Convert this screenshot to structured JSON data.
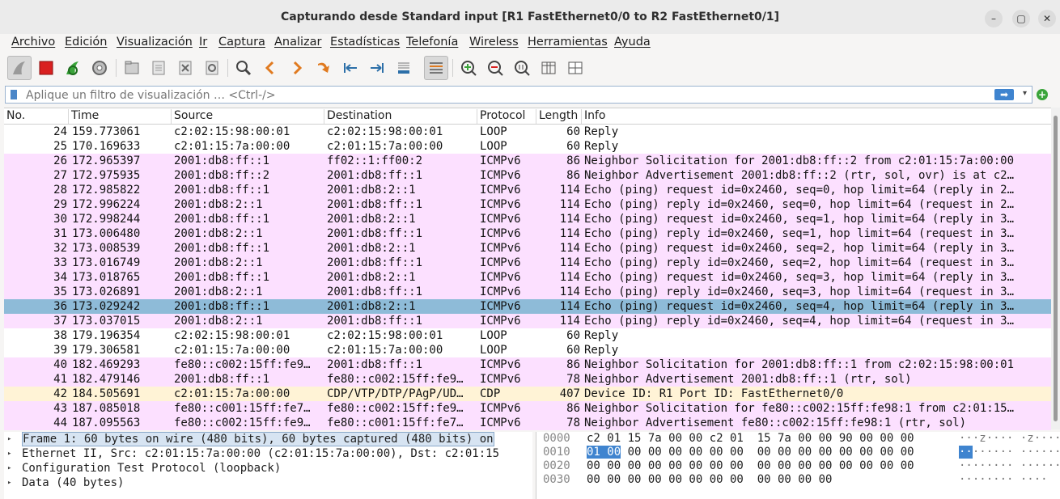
{
  "window": {
    "title": "Capturando desde Standard input [R1 FastEthernet0/0 to R2 FastEthernet0/1]",
    "minimize": "–",
    "maximize": "▢",
    "close": "✕"
  },
  "menu": [
    "Archivo",
    "Edición",
    "Visualización",
    "Ir",
    "Captura",
    "Analizar",
    "Estadísticas",
    "Telefonía",
    "Wireless",
    "Herramientas",
    "Ayuda"
  ],
  "toolbar_icons": [
    "shark-fin-icon",
    "stop-capture-icon",
    "restart-capture-icon",
    "capture-options-icon",
    "open-file-icon",
    "save-file-icon",
    "close-file-icon",
    "reload-file-icon",
    "find-packet-icon",
    "go-back-icon",
    "go-forward-icon",
    "go-to-packet-icon",
    "first-packet-icon",
    "last-packet-icon",
    "auto-scroll-icon",
    "colorize-icon",
    "zoom-in-icon",
    "zoom-out-icon",
    "normal-size-icon",
    "resize-columns-icon"
  ],
  "filter": {
    "placeholder": "Aplique un filtro de visualización … <Ctrl-/>",
    "apply": "➡",
    "dropdown": "▾",
    "add": "+"
  },
  "columns": [
    "No.",
    "Time",
    "Source",
    "Destination",
    "Protocol",
    "Length",
    "Info"
  ],
  "packets": [
    {
      "no": "24",
      "time": "159.773061",
      "src": "c2:02:15:98:00:01",
      "dst": "c2:02:15:98:00:01",
      "proto": "LOOP",
      "len": "60",
      "info": "Reply",
      "kind": "loop"
    },
    {
      "no": "25",
      "time": "170.169633",
      "src": "c2:01:15:7a:00:00",
      "dst": "c2:01:15:7a:00:00",
      "proto": "LOOP",
      "len": "60",
      "info": "Reply",
      "kind": "loop"
    },
    {
      "no": "26",
      "time": "172.965397",
      "src": "2001:db8:ff::1",
      "dst": "ff02::1:ff00:2",
      "proto": "ICMPv6",
      "len": "86",
      "info": "Neighbor Solicitation for 2001:db8:ff::2 from c2:01:15:7a:00:00",
      "kind": "icmp"
    },
    {
      "no": "27",
      "time": "172.975935",
      "src": "2001:db8:ff::2",
      "dst": "2001:db8:ff::1",
      "proto": "ICMPv6",
      "len": "86",
      "info": "Neighbor Advertisement 2001:db8:ff::2 (rtr, sol, ovr) is at c2…",
      "kind": "icmp"
    },
    {
      "no": "28",
      "time": "172.985822",
      "src": "2001:db8:ff::1",
      "dst": "2001:db8:2::1",
      "proto": "ICMPv6",
      "len": "114",
      "info": "Echo (ping) request id=0x2460, seq=0, hop limit=64 (reply in 2…",
      "kind": "icmp"
    },
    {
      "no": "29",
      "time": "172.996224",
      "src": "2001:db8:2::1",
      "dst": "2001:db8:ff::1",
      "proto": "ICMPv6",
      "len": "114",
      "info": "Echo (ping) reply id=0x2460, seq=0, hop limit=64 (request in 2…",
      "kind": "icmp"
    },
    {
      "no": "30",
      "time": "172.998244",
      "src": "2001:db8:ff::1",
      "dst": "2001:db8:2::1",
      "proto": "ICMPv6",
      "len": "114",
      "info": "Echo (ping) request id=0x2460, seq=1, hop limit=64 (reply in 3…",
      "kind": "icmp"
    },
    {
      "no": "31",
      "time": "173.006480",
      "src": "2001:db8:2::1",
      "dst": "2001:db8:ff::1",
      "proto": "ICMPv6",
      "len": "114",
      "info": "Echo (ping) reply id=0x2460, seq=1, hop limit=64 (request in 3…",
      "kind": "icmp"
    },
    {
      "no": "32",
      "time": "173.008539",
      "src": "2001:db8:ff::1",
      "dst": "2001:db8:2::1",
      "proto": "ICMPv6",
      "len": "114",
      "info": "Echo (ping) request id=0x2460, seq=2, hop limit=64 (reply in 3…",
      "kind": "icmp"
    },
    {
      "no": "33",
      "time": "173.016749",
      "src": "2001:db8:2::1",
      "dst": "2001:db8:ff::1",
      "proto": "ICMPv6",
      "len": "114",
      "info": "Echo (ping) reply id=0x2460, seq=2, hop limit=64 (request in 3…",
      "kind": "icmp"
    },
    {
      "no": "34",
      "time": "173.018765",
      "src": "2001:db8:ff::1",
      "dst": "2001:db8:2::1",
      "proto": "ICMPv6",
      "len": "114",
      "info": "Echo (ping) request id=0x2460, seq=3, hop limit=64 (reply in 3…",
      "kind": "icmp"
    },
    {
      "no": "35",
      "time": "173.026891",
      "src": "2001:db8:2::1",
      "dst": "2001:db8:ff::1",
      "proto": "ICMPv6",
      "len": "114",
      "info": "Echo (ping) reply id=0x2460, seq=3, hop limit=64 (request in 3…",
      "kind": "icmp"
    },
    {
      "no": "36",
      "time": "173.029242",
      "src": "2001:db8:ff::1",
      "dst": "2001:db8:2::1",
      "proto": "ICMPv6",
      "len": "114",
      "info": "Echo (ping) request id=0x2460, seq=4, hop limit=64 (reply in 3…",
      "kind": "sel"
    },
    {
      "no": "37",
      "time": "173.037015",
      "src": "2001:db8:2::1",
      "dst": "2001:db8:ff::1",
      "proto": "ICMPv6",
      "len": "114",
      "info": "Echo (ping) reply id=0x2460, seq=4, hop limit=64 (request in 3…",
      "kind": "icmp"
    },
    {
      "no": "38",
      "time": "179.196354",
      "src": "c2:02:15:98:00:01",
      "dst": "c2:02:15:98:00:01",
      "proto": "LOOP",
      "len": "60",
      "info": "Reply",
      "kind": "loop"
    },
    {
      "no": "39",
      "time": "179.306581",
      "src": "c2:01:15:7a:00:00",
      "dst": "c2:01:15:7a:00:00",
      "proto": "LOOP",
      "len": "60",
      "info": "Reply",
      "kind": "loop"
    },
    {
      "no": "40",
      "time": "182.469293",
      "src": "fe80::c002:15ff:fe9…",
      "dst": "2001:db8:ff::1",
      "proto": "ICMPv6",
      "len": "86",
      "info": "Neighbor Solicitation for 2001:db8:ff::1 from c2:02:15:98:00:01",
      "kind": "icmp"
    },
    {
      "no": "41",
      "time": "182.479146",
      "src": "2001:db8:ff::1",
      "dst": "fe80::c002:15ff:fe9…",
      "proto": "ICMPv6",
      "len": "78",
      "info": "Neighbor Advertisement 2001:db8:ff::1 (rtr, sol)",
      "kind": "icmp"
    },
    {
      "no": "42",
      "time": "184.505691",
      "src": "c2:01:15:7a:00:00",
      "dst": "CDP/VTP/DTP/PAgP/UD…",
      "proto": "CDP",
      "len": "407",
      "info": "Device ID: R1  Port ID: FastEthernet0/0",
      "kind": "cdp"
    },
    {
      "no": "43",
      "time": "187.085018",
      "src": "fe80::c001:15ff:fe7…",
      "dst": "fe80::c002:15ff:fe9…",
      "proto": "ICMPv6",
      "len": "86",
      "info": "Neighbor Solicitation for fe80::c002:15ff:fe98:1 from c2:01:15…",
      "kind": "icmp"
    },
    {
      "no": "44",
      "time": "187.095563",
      "src": "fe80::c002:15ff:fe9…",
      "dst": "fe80::c001:15ff:fe7…",
      "proto": "ICMPv6",
      "len": "78",
      "info": "Neighbor Advertisement fe80::c002:15ff:fe98:1 (rtr, sol)",
      "kind": "icmp"
    }
  ],
  "details": [
    {
      "text": "Frame 1: 60 bytes on wire (480 bits), 60 bytes captured (480 bits) on",
      "selected": true
    },
    {
      "text": "Ethernet II, Src: c2:01:15:7a:00:00 (c2:01:15:7a:00:00), Dst: c2:01:15",
      "selected": false
    },
    {
      "text": "Configuration Test Protocol (loopback)",
      "selected": false
    },
    {
      "text": "Data (40 bytes)",
      "selected": false
    }
  ],
  "detail_expander": "▸",
  "bytes": [
    {
      "off": "0000",
      "hex_pre": "",
      "hex_hl": "",
      "hex_post": "c2 01 15 7a 00 00 c2 01  15 7a 00 00 90 00 00 00",
      "asc_pre": "",
      "asc_hl": "",
      "asc_post": "···z···· ·z······"
    },
    {
      "off": "0010",
      "hex_pre": "",
      "hex_hl": "01 00",
      "hex_post": " 00 00 00 00 00 00  00 00 00 00 00 00 00 00",
      "asc_pre": "",
      "asc_hl": "··",
      "asc_post": "······ ········"
    },
    {
      "off": "0020",
      "hex_pre": "",
      "hex_hl": "",
      "hex_post": "00 00 00 00 00 00 00 00  00 00 00 00 00 00 00 00",
      "asc_pre": "",
      "asc_hl": "",
      "asc_post": "········ ········"
    },
    {
      "off": "0030",
      "hex_pre": "",
      "hex_hl": "",
      "hex_post": "00 00 00 00 00 00 00 00  00 00 00 00",
      "asc_pre": "",
      "asc_hl": "",
      "asc_post": "········ ····"
    }
  ],
  "colors": {
    "icmp_row": "#fce0ff",
    "loop_row": "#ffffff",
    "cdp_row": "#fff3d6",
    "selected_row": "#8ebbd8",
    "accent": "#3f84cf"
  }
}
